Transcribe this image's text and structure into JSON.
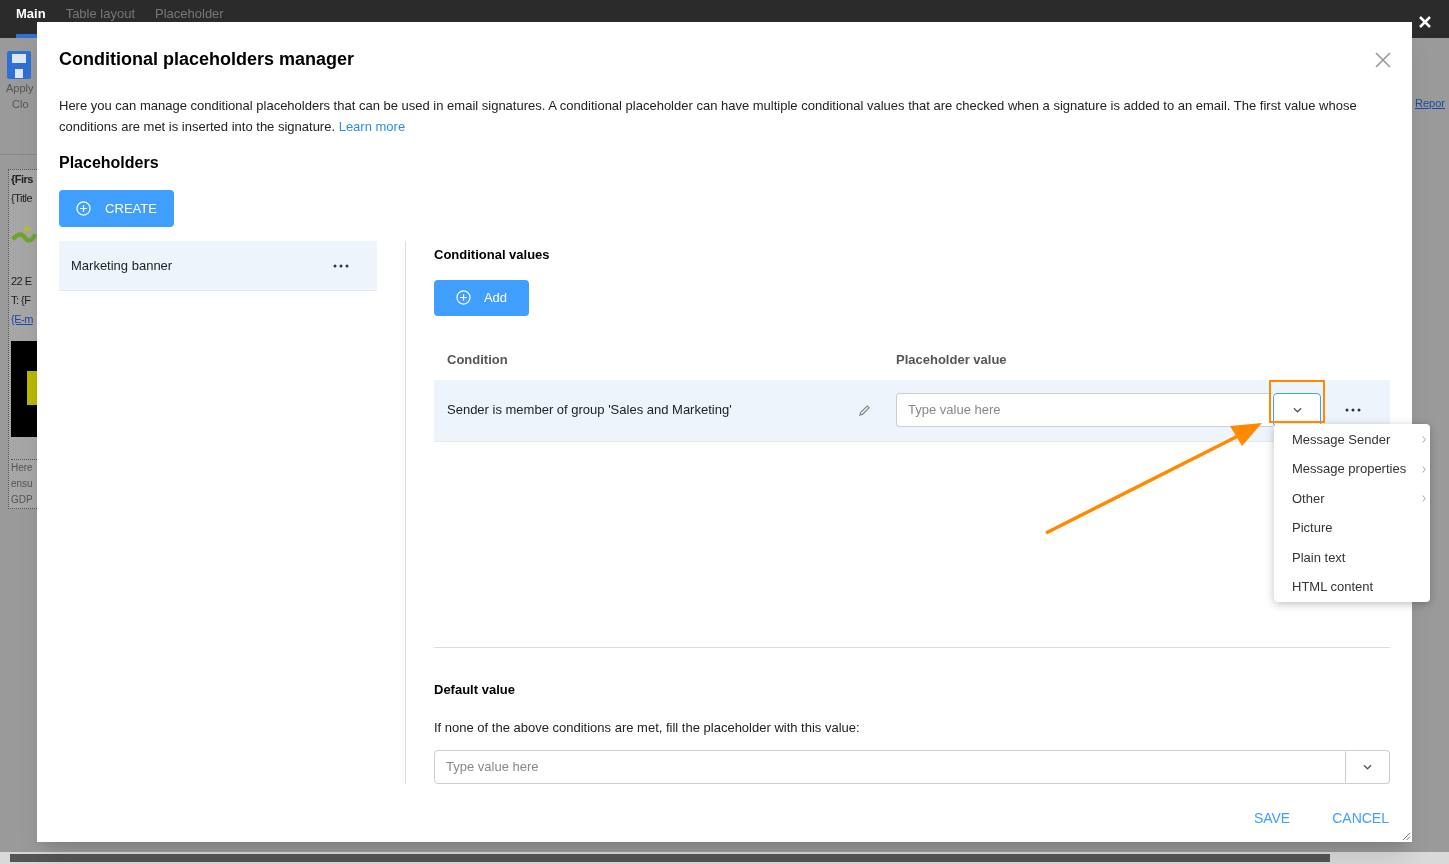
{
  "app": {
    "tabs": [
      {
        "label": "Main",
        "selected": true
      },
      {
        "label": "Table layout",
        "selected": false
      },
      {
        "label": "Placeholder",
        "selected": false
      }
    ],
    "ribbon_labels": [
      "Apply",
      "Clo"
    ],
    "document_lines": [
      {
        "text": "{Firs",
        "kind": "bold"
      },
      {
        "text": "{Title",
        "kind": "plain"
      },
      {
        "text": "22 E",
        "kind": "plain"
      },
      {
        "text": "T: {F",
        "kind": "plain"
      },
      {
        "text": "{E-m",
        "kind": "link"
      },
      {
        "text": "Here",
        "kind": "small"
      },
      {
        "text": "ensu",
        "kind": "small"
      },
      {
        "text": "GDP",
        "kind": "small"
      }
    ],
    "side_link": "Repor"
  },
  "dialog": {
    "title": "Conditional placeholders manager",
    "description": "Here you can manage conditional placeholders that can be used in email signatures. A conditional placeholder can have multiple conditional values that are checked when a signature is added to an email. The first value whose conditions are met is inserted into the signature.",
    "learn_more": "Learn more",
    "placeholders_heading": "Placeholders",
    "create_button": "CREATE",
    "placeholders": [
      {
        "label": "Marketing banner",
        "selected": true
      }
    ],
    "conditional_values": {
      "heading": "Conditional values",
      "add_button": "Add",
      "columns": [
        "Condition",
        "Placeholder value"
      ],
      "rows": [
        {
          "condition": "Sender is member of group 'Sales and Marketing'",
          "placeholder": "Type value here",
          "dropdown_open": true
        }
      ]
    },
    "value_menu": [
      {
        "label": "Message Sender",
        "submenu": true
      },
      {
        "label": "Message properties",
        "submenu": true
      },
      {
        "label": "Other",
        "submenu": true
      },
      {
        "label": "Picture",
        "submenu": false
      },
      {
        "label": "Plain text",
        "submenu": false
      },
      {
        "label": "HTML content",
        "submenu": false
      }
    ],
    "default_value": {
      "heading": "Default value",
      "description": "If none of the above conditions are met, fill the placeholder with this value:",
      "placeholder": "Type value here"
    },
    "buttons": [
      "SAVE",
      "CANCEL"
    ]
  }
}
